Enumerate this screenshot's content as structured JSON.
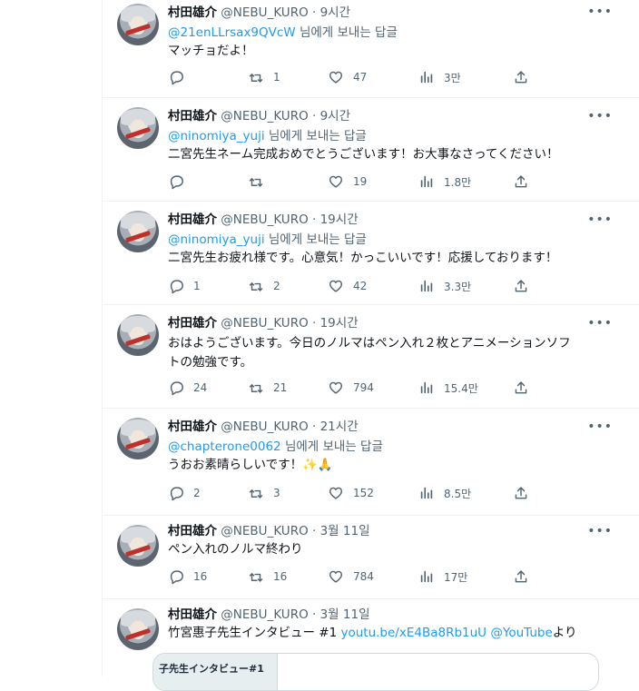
{
  "tweets": [
    {
      "name": "村田雄介",
      "handle": "@NEBU_KURO",
      "sep": "·",
      "time": "9시간",
      "reply_to": "@21enLLrsax9QVcW",
      "reply_suffix": " 님에게 보내는 답글",
      "text": "マッチョだよ！",
      "counts": {
        "reply": "",
        "retweet": "1",
        "like": "47",
        "views": "3만"
      }
    },
    {
      "name": "村田雄介",
      "handle": "@NEBU_KURO",
      "sep": "·",
      "time": "9시간",
      "reply_to": "@ninomiya_yuji",
      "reply_suffix": " 님에게 보내는 답글",
      "text": "二宮先生ネーム完成おめでとうございます！お大事なさってください！",
      "counts": {
        "reply": "",
        "retweet": "",
        "like": "19",
        "views": "1.8만"
      }
    },
    {
      "name": "村田雄介",
      "handle": "@NEBU_KURO",
      "sep": "·",
      "time": "19시간",
      "reply_to": "@ninomiya_yuji",
      "reply_suffix": " 님에게 보내는 답글",
      "text": "二宮先生お疲れ様です。心意気！かっこいいです！応援しております！",
      "counts": {
        "reply": "1",
        "retweet": "2",
        "like": "42",
        "views": "3.3만"
      }
    },
    {
      "name": "村田雄介",
      "handle": "@NEBU_KURO",
      "sep": "·",
      "time": "19시간",
      "text_line1": "おはようございます。今日のノルマはペン入れ２枚とアニメーションソフ",
      "text_line2": "トの勉強です。",
      "counts": {
        "reply": "24",
        "retweet": "21",
        "like": "794",
        "views": "15.4만"
      }
    },
    {
      "name": "村田雄介",
      "handle": "@NEBU_KURO",
      "sep": "·",
      "time": "21시간",
      "reply_to": "@chapterone0062",
      "reply_suffix": " 님에게 보내는 답글",
      "text": "うおお素晴らしいです！✨🙏",
      "counts": {
        "reply": "2",
        "retweet": "3",
        "like": "152",
        "views": "8.5만"
      }
    },
    {
      "name": "村田雄介",
      "handle": "@NEBU_KURO",
      "sep": "·",
      "time": "3월 11일",
      "text": "ペン入れのノルマ終わり",
      "counts": {
        "reply": "16",
        "retweet": "16",
        "like": "784",
        "views": "17만"
      }
    },
    {
      "name": "村田雄介",
      "handle": "@NEBU_KURO",
      "sep": "·",
      "time": "3월 11일",
      "text_prefix": "竹宮惠子先生インタビュー #1 ",
      "link1": "youtu.be/xE4Ba8Rb1uU",
      "link2": "@YouTube",
      "text_suffix": "より",
      "card_text": "子先生インタビュー#1"
    }
  ],
  "icons": {
    "more": "more-horizontal-icon",
    "reply": "speech-bubble-icon",
    "retweet": "retweet-arrows-icon",
    "like": "heart-icon",
    "views": "bar-chart-icon",
    "share": "upload-arrow-icon"
  }
}
